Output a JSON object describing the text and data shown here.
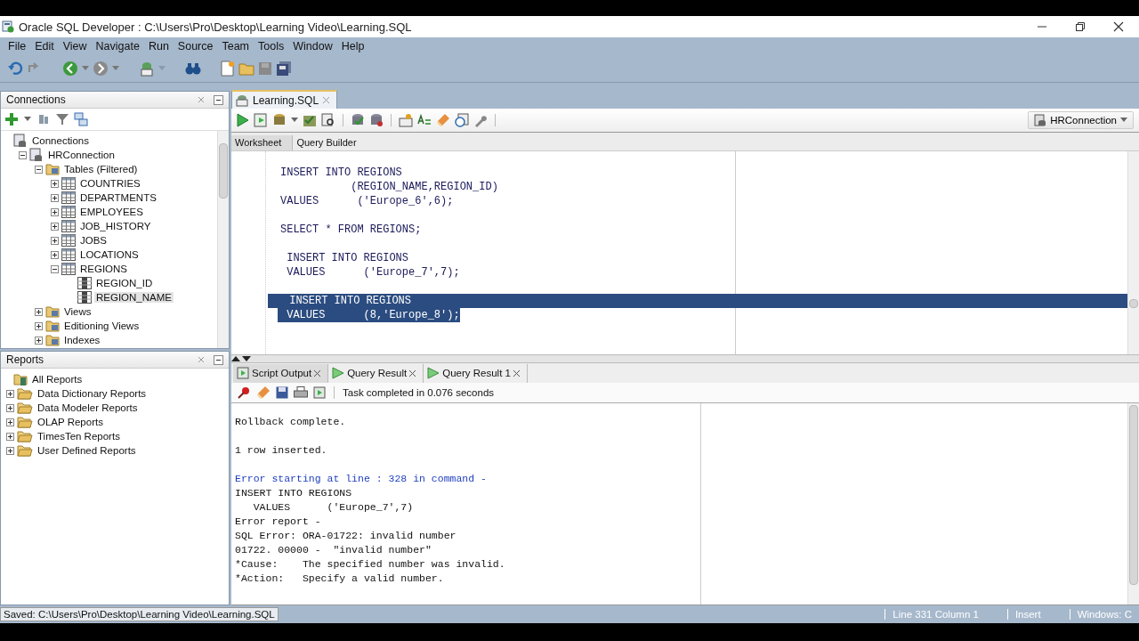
{
  "window": {
    "title": "Oracle SQL Developer : C:\\Users\\Pro\\Desktop\\Learning Video\\Learning.SQL"
  },
  "menu": [
    "File",
    "Edit",
    "View",
    "Navigate",
    "Run",
    "Source",
    "Team",
    "Tools",
    "Window",
    "Help"
  ],
  "connections_panel": {
    "title": "Connections",
    "tree": [
      {
        "label": "Connections",
        "kind": "connections",
        "children": [
          {
            "label": "HRConnection",
            "kind": "connection",
            "expanded": true,
            "children": [
              {
                "label": "Tables (Filtered)",
                "kind": "folder",
                "expanded": true,
                "children": [
                  {
                    "label": "COUNTRIES",
                    "kind": "table",
                    "expanded": false,
                    "selected": false
                  },
                  {
                    "label": "DEPARTMENTS",
                    "kind": "table",
                    "expanded": false,
                    "selected": false
                  },
                  {
                    "label": "EMPLOYEES",
                    "kind": "table",
                    "expanded": false,
                    "selected": false
                  },
                  {
                    "label": "JOB_HISTORY",
                    "kind": "table",
                    "expanded": false,
                    "selected": false
                  },
                  {
                    "label": "JOBS",
                    "kind": "table",
                    "expanded": false,
                    "selected": false
                  },
                  {
                    "label": "LOCATIONS",
                    "kind": "table",
                    "expanded": false,
                    "selected": false
                  },
                  {
                    "label": "REGIONS",
                    "kind": "table",
                    "expanded": true,
                    "selected": false,
                    "children": [
                      {
                        "label": "REGION_ID",
                        "kind": "column",
                        "selected": false
                      },
                      {
                        "label": "REGION_NAME",
                        "kind": "column",
                        "selected": true
                      }
                    ]
                  }
                ]
              },
              {
                "label": "Views",
                "kind": "folder",
                "expanded": false
              },
              {
                "label": "Editioning Views",
                "kind": "folder",
                "expanded": false
              },
              {
                "label": "Indexes",
                "kind": "folder",
                "expanded": false
              }
            ]
          }
        ]
      }
    ]
  },
  "reports_panel": {
    "title": "Reports",
    "tree": [
      {
        "label": "All Reports",
        "kind": "reports",
        "children": [
          {
            "label": "Data Dictionary Reports",
            "kind": "report-folder",
            "expanded": false
          },
          {
            "label": "Data Modeler Reports",
            "kind": "report-folder",
            "expanded": false
          },
          {
            "label": "OLAP Reports",
            "kind": "report-folder",
            "expanded": false
          },
          {
            "label": "TimesTen Reports",
            "kind": "report-folder",
            "expanded": false
          },
          {
            "label": "User Defined Reports",
            "kind": "report-folder",
            "expanded": false
          }
        ]
      }
    ]
  },
  "editor": {
    "tabs": [
      {
        "label": "Learning.SQL",
        "selected": true
      }
    ],
    "connection": "HRConnection",
    "subtabs": [
      {
        "label": "Worksheet",
        "selected": true
      },
      {
        "label": "Query Builder",
        "selected": false
      }
    ],
    "code": [
      {
        "selected": false,
        "lines": [
          "INSERT INTO REGIONS",
          "           (REGION_NAME,REGION_ID)",
          "VALUES      ('Europe_6',6);"
        ]
      },
      {
        "selected": false,
        "lines": [
          "SELECT * FROM REGIONS;"
        ]
      },
      {
        "selected": false,
        "lines": [
          " INSERT INTO REGIONS",
          " VALUES      ('Europe_7',7);"
        ]
      },
      {
        "selected": true,
        "lines": [
          " INSERT INTO REGIONS",
          " VALUES      (8,'Europe_8');"
        ]
      }
    ]
  },
  "output": {
    "tabs": [
      {
        "label": "Script Output",
        "kind": "script",
        "selected": true
      },
      {
        "label": "Query Result",
        "kind": "query",
        "selected": false
      },
      {
        "label": "Query Result 1",
        "kind": "query",
        "selected": false
      }
    ],
    "message": "Task completed in 0.076 seconds",
    "blocks": [
      [
        {
          "text": "Rollback complete.",
          "kind": "plain"
        }
      ],
      [
        {
          "text": "1 row inserted.",
          "kind": "plain"
        }
      ],
      [
        {
          "text": "Error starting at line : 328 in command -",
          "kind": "error"
        },
        {
          "text": "INSERT INTO REGIONS",
          "kind": "plain"
        },
        {
          "text": "   VALUES      ('Europe_7',7)",
          "kind": "plain"
        },
        {
          "text": "Error report -",
          "kind": "plain"
        },
        {
          "text": "SQL Error: ORA-01722: invalid number",
          "kind": "plain"
        },
        {
          "text": "01722. 00000 -  \"invalid number\"",
          "kind": "plain"
        },
        {
          "text": "*Cause:    The specified number was invalid.",
          "kind": "plain"
        },
        {
          "text": "*Action:   Specify a valid number.",
          "kind": "plain"
        }
      ]
    ]
  },
  "status_bar": {
    "message": "Saved: C:\\Users\\Pro\\Desktop\\Learning Video\\Learning.SQL",
    "fields": [
      "Line 331 Column 1",
      "Insert",
      "Windows: C"
    ]
  }
}
